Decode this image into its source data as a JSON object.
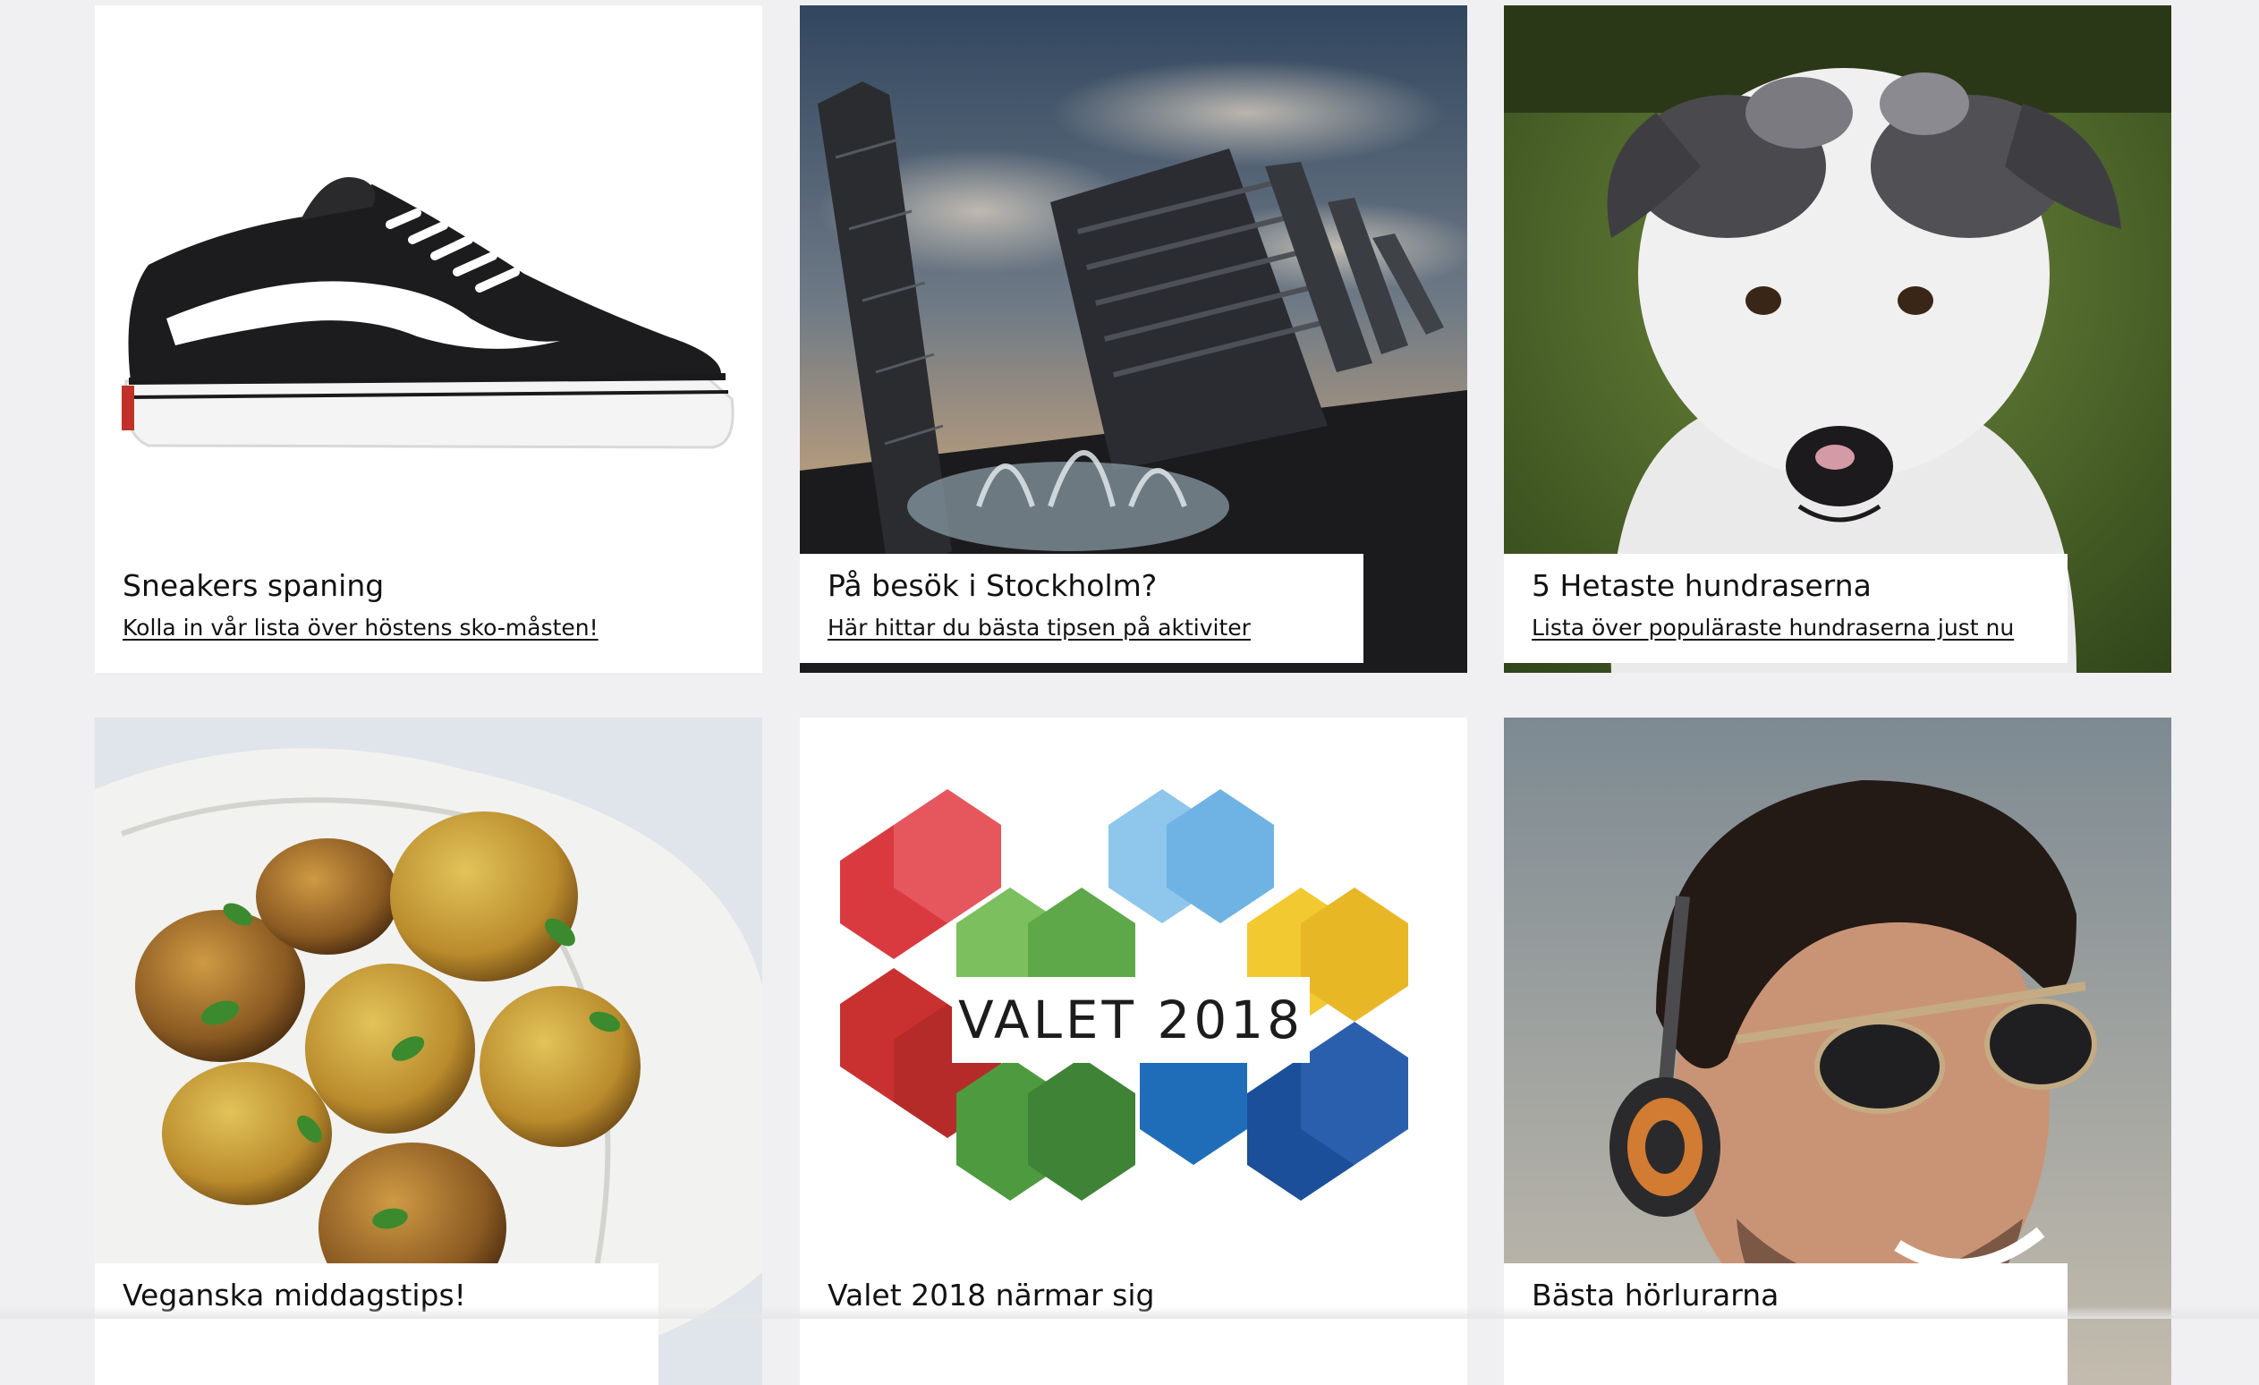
{
  "cards": [
    {
      "title": "Sneakers spaning",
      "link": "Kolla in vår lista över höstens sko-måsten!",
      "image": "sneaker-image"
    },
    {
      "title": "På besök i Stockholm?",
      "link": "Här hittar du bästa tipsen på aktiviter",
      "image": "stockholm-city-image"
    },
    {
      "title": "5 Hetaste hundraserna",
      "link": "Lista över populäraste hundraserna just nu",
      "image": "puppy-image"
    },
    {
      "title": "Veganska middagstips!",
      "image": "falafel-image"
    },
    {
      "title": "Valet 2018 närmar sig",
      "image": "valet-2018-logo",
      "badge": "VALET 2018"
    },
    {
      "title": "Bästa hörlurarna",
      "image": "man-with-headphones-image"
    }
  ]
}
